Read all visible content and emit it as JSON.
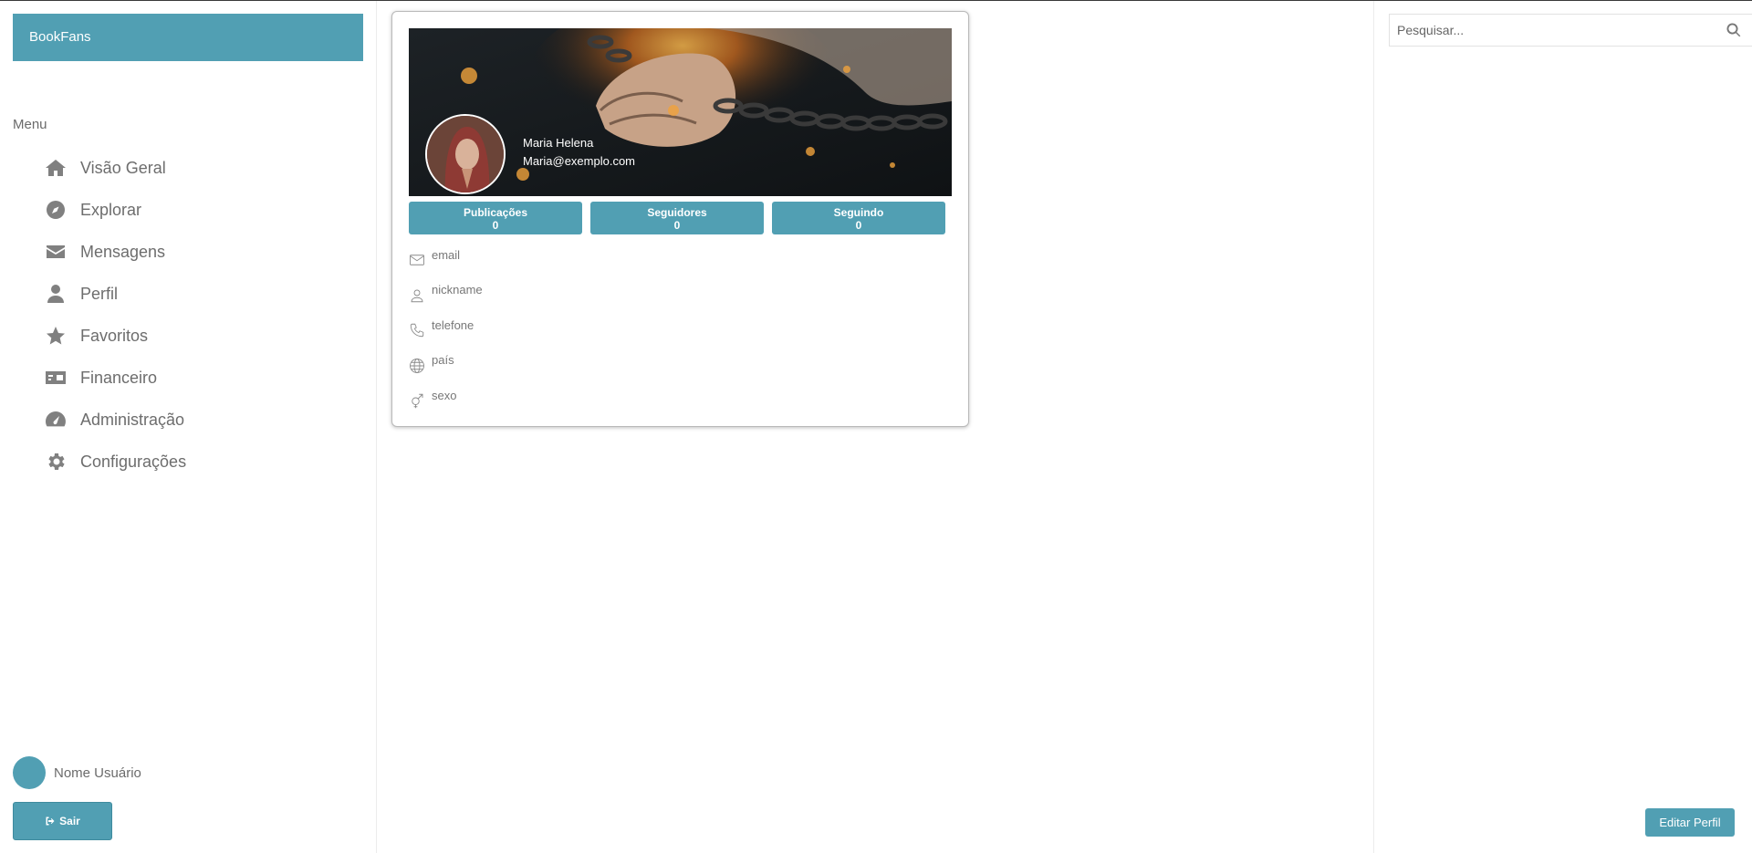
{
  "brand": {
    "name": "BookFans"
  },
  "menu": {
    "title": "Menu",
    "items": [
      {
        "label": "Visão Geral",
        "icon": "home-icon"
      },
      {
        "label": "Explorar",
        "icon": "compass-icon"
      },
      {
        "label": "Mensagens",
        "icon": "envelope-icon"
      },
      {
        "label": "Perfil",
        "icon": "user-icon"
      },
      {
        "label": "Favoritos",
        "icon": "star-icon"
      },
      {
        "label": "Financeiro",
        "icon": "money-bill-icon"
      },
      {
        "label": "Administração",
        "icon": "dashboard-gauge-icon"
      },
      {
        "label": "Configurações",
        "icon": "gear-icon"
      }
    ]
  },
  "user": {
    "name": "Nome Usuário",
    "logout_label": "Sair"
  },
  "profile": {
    "name": "Maria Helena",
    "email": "Maria@exemplo.com",
    "stats": [
      {
        "label": "Publicações",
        "value": "0"
      },
      {
        "label": "Seguidores",
        "value": "0"
      },
      {
        "label": "Seguindo",
        "value": "0"
      }
    ],
    "info": [
      {
        "label": "email",
        "icon": "envelope-outline-icon"
      },
      {
        "label": "nickname",
        "icon": "person-outline-icon"
      },
      {
        "label": "telefone",
        "icon": "phone-icon"
      },
      {
        "label": "país",
        "icon": "globe-icon"
      },
      {
        "label": "sexo",
        "icon": "gender-icon"
      }
    ]
  },
  "search": {
    "placeholder": "Pesquisar..."
  },
  "actions": {
    "edit_profile_label": "Editar Perfil"
  },
  "colors": {
    "accent": "#519fb3",
    "text": "#6b6b6b"
  }
}
